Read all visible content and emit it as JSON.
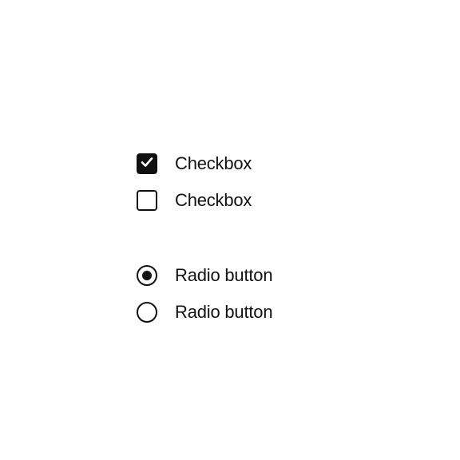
{
  "checkboxes": [
    {
      "label": "Checkbox",
      "checked": true
    },
    {
      "label": "Checkbox",
      "checked": false
    }
  ],
  "radios": [
    {
      "label": "Radio button",
      "selected": true
    },
    {
      "label": "Radio button",
      "selected": false
    }
  ]
}
